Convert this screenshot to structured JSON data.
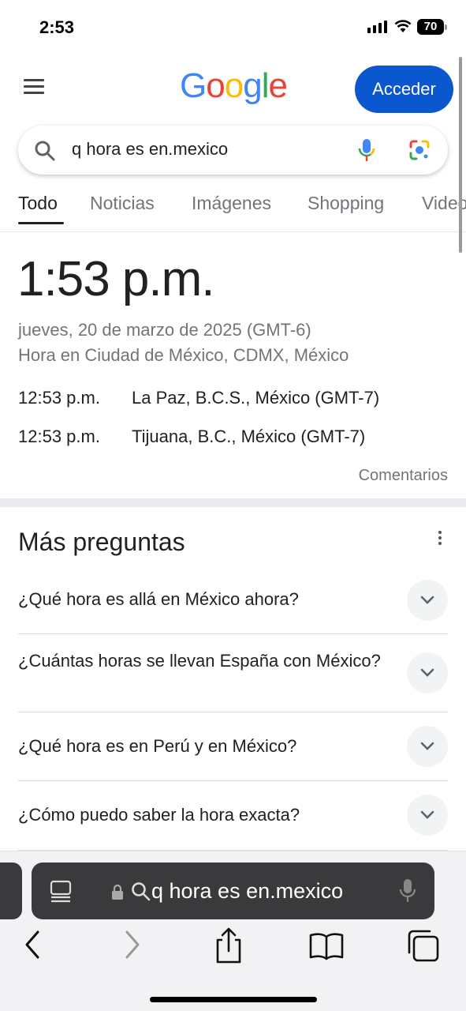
{
  "status_bar": {
    "time": "2:53",
    "battery": "70"
  },
  "header": {
    "logo_text": "Google",
    "signin_label": "Acceder"
  },
  "search": {
    "query": "q hora es en.mexico"
  },
  "tabs": [
    {
      "label": "Todo",
      "active": true
    },
    {
      "label": "Noticias",
      "active": false
    },
    {
      "label": "Imágenes",
      "active": false
    },
    {
      "label": "Shopping",
      "active": false
    },
    {
      "label": "Videos",
      "active": false
    }
  ],
  "time_card": {
    "time": "1:53 p.m.",
    "date": "jueves, 20 de marzo de 2025 (GMT-6)",
    "location": "Hora en Ciudad de México, CDMX, México",
    "other_zones": [
      {
        "time": "12:53 p.m.",
        "location": "La Paz, B.C.S., México (GMT-7)"
      },
      {
        "time": "12:53 p.m.",
        "location": "Tijuana, B.C., México (GMT-7)"
      }
    ],
    "feedback_label": "Comentarios"
  },
  "people_also_ask": {
    "title": "Más preguntas",
    "questions": [
      "¿Qué hora es allá en México ahora?",
      "¿Cuántas horas se llevan España con México?",
      "¿Qué hora es en Perú y en México?",
      "¿Cómo puedo saber la hora exacta?"
    ]
  },
  "browser": {
    "url_text": "q hora es en.mexico"
  },
  "colors": {
    "accent": "#0b57d0",
    "google_blue": "#4285F4",
    "google_red": "#EA4335",
    "google_yellow": "#FBBC05",
    "google_green": "#34A853"
  }
}
